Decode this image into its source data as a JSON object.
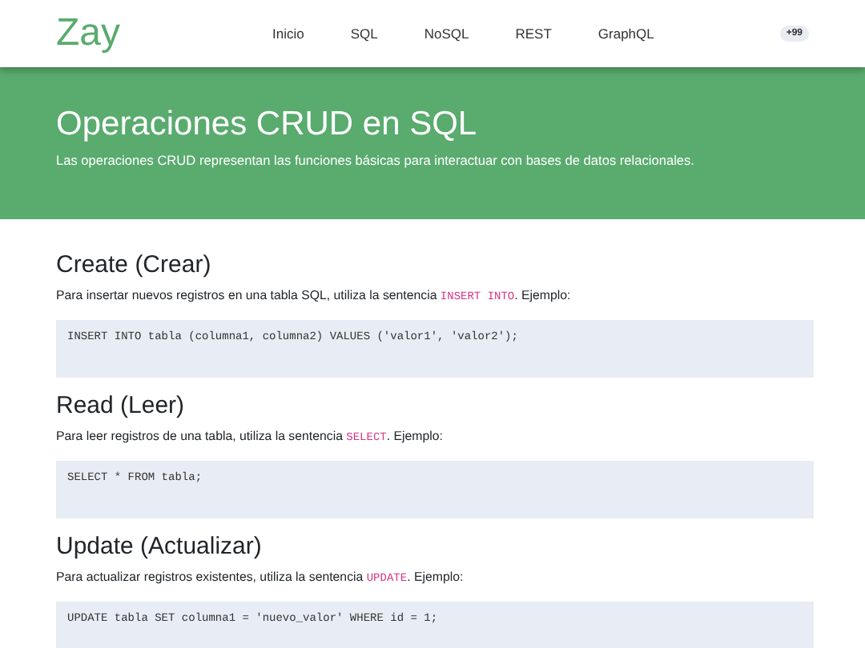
{
  "nav": {
    "logo": "Zay",
    "links": [
      "Inicio",
      "SQL",
      "NoSQL",
      "REST",
      "GraphQL"
    ],
    "badge": "+99"
  },
  "hero": {
    "title": "Operaciones CRUD en SQL",
    "subtitle": "Las operaciones CRUD representan las funciones básicas para interactuar con bases de datos relacionales."
  },
  "sections": [
    {
      "heading": "Create (Crear)",
      "text_before": "Para insertar nuevos registros en una tabla SQL, utiliza la sentencia ",
      "keyword": "INSERT INTO",
      "text_after": ". Ejemplo:",
      "code": "INSERT INTO tabla (columna1, columna2) VALUES ('valor1', 'valor2');"
    },
    {
      "heading": "Read (Leer)",
      "text_before": "Para leer registros de una tabla, utiliza la sentencia ",
      "keyword": "SELECT",
      "text_after": ". Ejemplo:",
      "code": "SELECT * FROM tabla;"
    },
    {
      "heading": "Update (Actualizar)",
      "text_before": "Para actualizar registros existentes, utiliza la sentencia ",
      "keyword": "UPDATE",
      "text_after": ". Ejemplo:",
      "code": "UPDATE tabla SET columna1 = 'nuevo_valor' WHERE id = 1;"
    }
  ]
}
